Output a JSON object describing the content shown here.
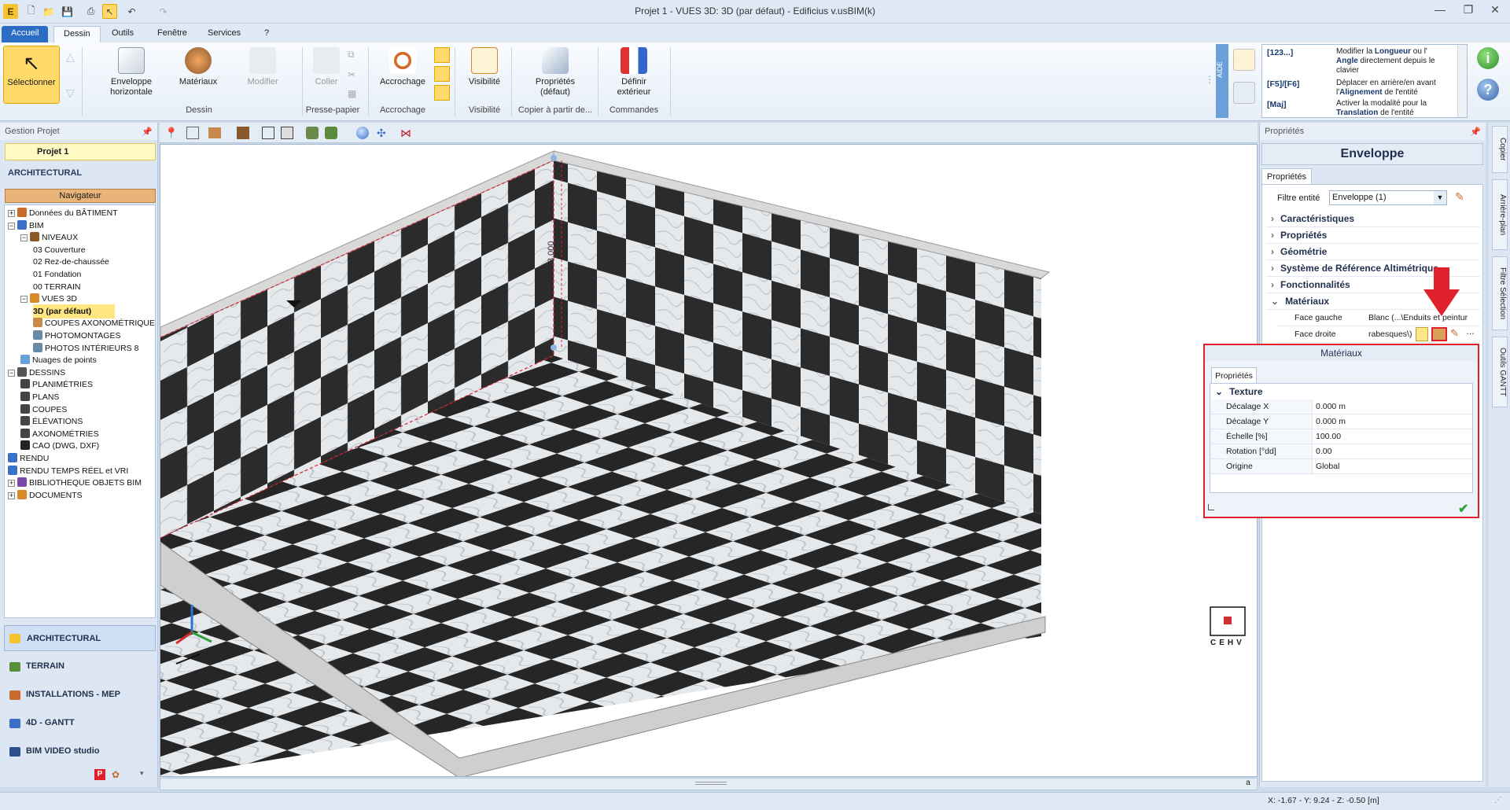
{
  "window": {
    "title": "Projet 1 -  VUES 3D: 3D (par défaut) - Edificius v.usBIM(k)"
  },
  "ribbon": {
    "tabs": [
      "Accueil",
      "Dessin",
      "Outils",
      "Fenêtre",
      "Services",
      "?"
    ],
    "active_tab": "Dessin",
    "buttons": {
      "select": "Sélectionner",
      "envelope": "Enveloppe horizontale",
      "materials": "Matériaux",
      "modify": "Modifier",
      "paste": "Coller",
      "snap": "Accrochage",
      "visibility": "Visibilité",
      "properties": "Propriétés (défaut)",
      "exterior": "Définir extérieur"
    },
    "groups": [
      "Dessin",
      "Presse-papier",
      "Accrochage",
      "Visibilité",
      "Copier à partir de...",
      "Commandes"
    ]
  },
  "help": {
    "side_label": "AIDE",
    "rows": [
      {
        "key": "[123...]",
        "text_a": "Modifier la ",
        "bold_a": "Longueur",
        "text_b": " ou l'",
        "bold_b": "Angle",
        "text_c": " directement depuis le clavier"
      },
      {
        "key": "[F5]/[F6]",
        "text_a": "Déplacer en arrière/en avant l'",
        "bold_a": "Alignement",
        "text_b": " de l'entité",
        "bold_b": "",
        "text_c": ""
      },
      {
        "key": "[Maj]",
        "text_a": "Activer la modalité pour la ",
        "bold_a": "Translation",
        "text_b": " de l'entité",
        "bold_b": "",
        "text_c": ""
      }
    ]
  },
  "left_panel": {
    "header": "Gestion Projet",
    "project": "Projet 1",
    "section": "ARCHITECTURAL",
    "navigator": "Navigateur",
    "tree": [
      {
        "label": "Données du BÂTIMENT",
        "level": 0,
        "expand": "+",
        "icon": "building"
      },
      {
        "label": "BIM",
        "level": 0,
        "expand": "−",
        "icon": "bim"
      },
      {
        "label": "NIVEAUX",
        "level": 1,
        "expand": "−",
        "icon": "levels"
      },
      {
        "label": "03 Couverture",
        "level": 2,
        "expand": "",
        "icon": ""
      },
      {
        "label": "02 Rez-de-chaussée",
        "level": 2,
        "expand": "",
        "icon": ""
      },
      {
        "label": "01 Fondation",
        "level": 2,
        "expand": "",
        "icon": ""
      },
      {
        "label": "00 TERRAIN",
        "level": 2,
        "expand": "",
        "icon": ""
      },
      {
        "label": "VUES 3D",
        "level": 1,
        "expand": "−",
        "icon": "views3d"
      },
      {
        "label": "3D (par défaut)",
        "level": 2,
        "expand": "",
        "icon": "",
        "selected": true
      },
      {
        "label": "COUPES AXONOMÉTRIQUES",
        "level": 2,
        "expand": "",
        "icon": "cube"
      },
      {
        "label": "PHOTOMONTAGES",
        "level": 2,
        "expand": "",
        "icon": "photo"
      },
      {
        "label": "PHOTOS INTÉRIEURS 8",
        "level": 2,
        "expand": "",
        "icon": "photo"
      },
      {
        "label": "Nuages de points",
        "level": 1,
        "expand": "",
        "icon": "cloud"
      },
      {
        "label": "DESSINS",
        "level": 0,
        "expand": "−",
        "icon": "drawings"
      },
      {
        "label": "PLANIMÉTRIES",
        "level": 1,
        "expand": "",
        "icon": "plan"
      },
      {
        "label": "PLANS",
        "level": 1,
        "expand": "",
        "icon": "plan"
      },
      {
        "label": "COUPES",
        "level": 1,
        "expand": "",
        "icon": "plan"
      },
      {
        "label": "ÉLÉVATIONS",
        "level": 1,
        "expand": "",
        "icon": "plan"
      },
      {
        "label": "AXONOMÉTRIES",
        "level": 1,
        "expand": "",
        "icon": "plan"
      },
      {
        "label": "CAO (DWG, DXF)",
        "level": 1,
        "expand": "",
        "icon": "cad"
      },
      {
        "label": "RENDU",
        "level": 0,
        "expand": "",
        "icon": "render"
      },
      {
        "label": "RENDU TEMPS RÉEL et VRI",
        "level": 0,
        "expand": "",
        "icon": "render"
      },
      {
        "label": "BIBLIOTHEQUE OBJETS BIM",
        "level": 0,
        "expand": "+",
        "icon": "library"
      },
      {
        "label": "DOCUMENTS",
        "level": 0,
        "expand": "+",
        "icon": "docs"
      }
    ],
    "modules": [
      "ARCHITECTURAL",
      "TERRAIN",
      "INSTALLATIONS - MEP",
      "4D - GANTT",
      "BIM VIDEO studio"
    ]
  },
  "viewport": {
    "dimension_label": "3.000",
    "view_cube_letters": [
      "C",
      "E",
      "H",
      "V"
    ]
  },
  "right_panel": {
    "header": "Propriétés",
    "title": "Enveloppe",
    "tab": "Propriétés",
    "filter_label": "Filtre entité",
    "filter_value": "Enveloppe (1)",
    "sections": [
      "Caractéristiques",
      "Propriétés",
      "Géométrie",
      "Système de Référence Altimétrique",
      "Fonctionnalités",
      "Matériaux"
    ],
    "materials_rows": [
      {
        "label": "Face gauche",
        "value": "Blanc   (...\\Enduits et peintur"
      },
      {
        "label": "Face droite",
        "value": "rabesques\\)"
      }
    ]
  },
  "side_tabs": [
    "Copier",
    "Arrière-plan",
    "Filtre Sélection",
    "Outils GANTT"
  ],
  "materials_popup": {
    "title": "Matériaux",
    "tab": "Propriétés",
    "section": "Texture",
    "rows": [
      {
        "label": "Décalage X",
        "value": "0.000 m"
      },
      {
        "label": "Décalage Y",
        "value": "0.000 m"
      },
      {
        "label": "Échelle  [%]",
        "value": "100.00"
      },
      {
        "label": "Rotation  [°dd]",
        "value": "0.00"
      },
      {
        "label": "Origine",
        "value": "Global"
      }
    ]
  },
  "status": {
    "coords": "X: -1.67 - Y: 9.24 - Z: -0.50 [m]",
    "mini_btn": "a"
  },
  "colors": {
    "accent": "#2b6cc4",
    "highlight": "#ffe680",
    "alert_red": "#e0212b"
  }
}
